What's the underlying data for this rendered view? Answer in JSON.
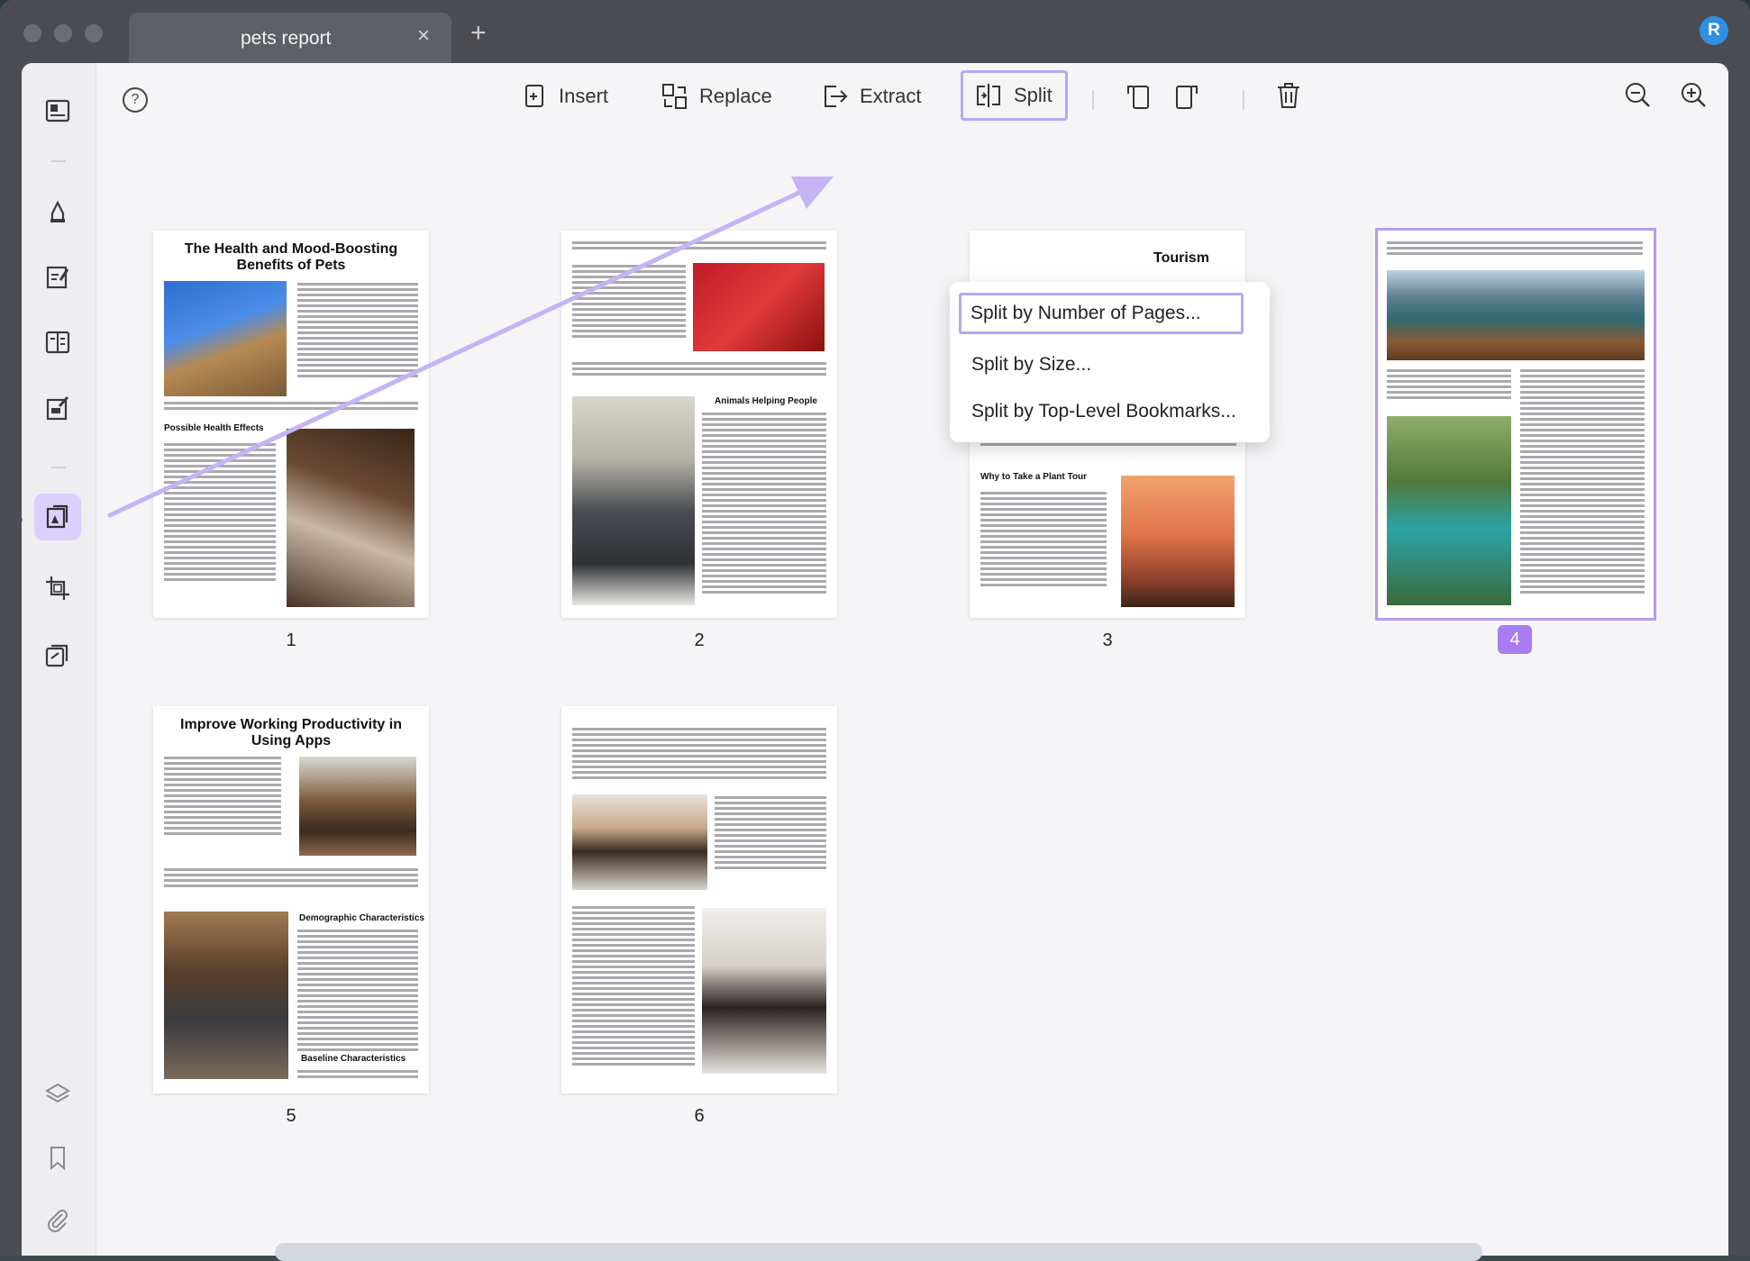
{
  "window": {
    "tab_title": "pets report",
    "tab_close": "×",
    "new_tab": "+",
    "avatar_letter": "R"
  },
  "toolbar": {
    "help": "?",
    "insert": "Insert",
    "replace": "Replace",
    "extract": "Extract",
    "split": "Split"
  },
  "split_menu": {
    "items": [
      "Split by Number of Pages...",
      "Split by Size...",
      "Split by Top-Level Bookmarks..."
    ]
  },
  "pages": [
    {
      "number": "1",
      "title": "The Health and Mood-Boosting Benefits of Pets",
      "heading": "Possible Health Effects"
    },
    {
      "number": "2",
      "heading": "Animals Helping People"
    },
    {
      "number": "3",
      "title": "Tourism",
      "heading": "Why to Take a Plant Tour"
    },
    {
      "number": "4"
    },
    {
      "number": "5",
      "title": "Improve Working Productivity in Using Apps",
      "heading": "Demographic Characteristics",
      "heading2": "Baseline Characteristics"
    },
    {
      "number": "6"
    }
  ],
  "colors": {
    "accent": "#a97cf2",
    "accent_light": "#dccffb",
    "annotation_arrow": "#c5b3f6"
  }
}
